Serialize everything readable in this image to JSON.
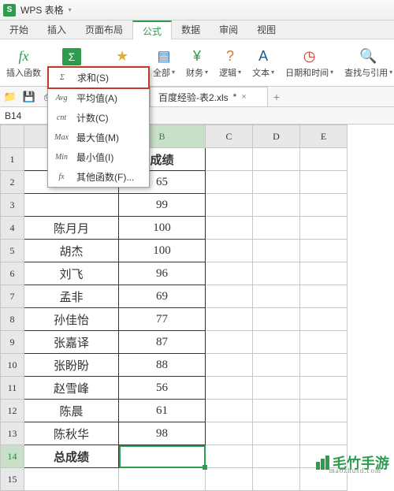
{
  "titlebar": {
    "app_name": "WPS 表格",
    "dropdown_items": []
  },
  "menu_tabs": [
    "开始",
    "插入",
    "页面布局",
    "公式",
    "数据",
    "审阅",
    "视图"
  ],
  "menu_active_index": 3,
  "ribbon": {
    "insert_fn": "插入函数",
    "autosum": "自动求和",
    "common_fn": "常用函数",
    "all": "全部",
    "finance": "财务",
    "logic": "逻辑",
    "text": "文本",
    "datetime": "日期和时间",
    "lookup": "查找与引用"
  },
  "autosum_menu": [
    {
      "icon": "Σ",
      "label": "求和(S)",
      "highlight": true
    },
    {
      "icon": "Avg",
      "label": "平均值(A)"
    },
    {
      "icon": "cnt",
      "label": "计数(C)"
    },
    {
      "icon": "Max",
      "label": "最大值(M)"
    },
    {
      "icon": "Min",
      "label": "最小值(I)"
    },
    {
      "icon": "fx",
      "label": "其他函数(F)..."
    }
  ],
  "qa_icons": [
    "folder",
    "save",
    "print",
    "preview",
    "undo",
    "redo"
  ],
  "doc_tab": {
    "title": "百度经验-表2.xls",
    "modified": "*"
  },
  "name_box": "B14",
  "columns": [
    "A",
    "B",
    "C",
    "D",
    "E"
  ],
  "selected_col": "B",
  "selected_row": 14,
  "grid": {
    "header_a": "",
    "header_b": "成绩",
    "rows": [
      {
        "a": "",
        "b": "65"
      },
      {
        "a": "",
        "b": "99"
      },
      {
        "a": "陈月月",
        "b": "100"
      },
      {
        "a": "胡杰",
        "b": "100"
      },
      {
        "a": "刘飞",
        "b": "96"
      },
      {
        "a": "孟非",
        "b": "69"
      },
      {
        "a": "孙佳怡",
        "b": "77"
      },
      {
        "a": "张嘉译",
        "b": "87"
      },
      {
        "a": "张盼盼",
        "b": "88"
      },
      {
        "a": "赵雪峰",
        "b": "56"
      },
      {
        "a": "陈晨",
        "b": "61"
      },
      {
        "a": "陈秋华",
        "b": "98"
      }
    ],
    "total_row": {
      "a": "总成绩",
      "b": ""
    }
  },
  "watermark": {
    "text": "毛竹手游",
    "sub": "maozhusd.com"
  }
}
